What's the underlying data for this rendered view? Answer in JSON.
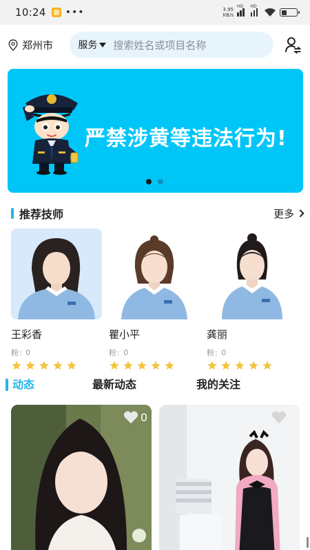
{
  "status_bar": {
    "time": "10:24",
    "dots": "•••",
    "net_speed_value": "3.95",
    "net_speed_unit": "KB/s",
    "signal_tag": "HD",
    "battery_level": 0.35
  },
  "header": {
    "city": "郑州市",
    "search_category": "服务",
    "search_placeholder": "搜索姓名或项目名称"
  },
  "banner": {
    "text": "严禁涉黄等违法行为!",
    "slide_count": 2,
    "active_slide": 1
  },
  "technicians_section": {
    "title": "推荐技师",
    "more_label": "更多",
    "items": [
      {
        "name": "王彩香",
        "fans": "粉: 0",
        "rating": 5
      },
      {
        "name": "瞿小平",
        "fans": "粉: 0",
        "rating": 5
      },
      {
        "name": "龚丽",
        "fans": "粉: 0",
        "rating": 5
      }
    ]
  },
  "feed_tabs": [
    {
      "label": "动态"
    },
    {
      "label": "最新动态"
    },
    {
      "label": "我的关注"
    }
  ],
  "feed": {
    "cards": [
      {
        "likes": "0"
      },
      {
        "likes": ""
      }
    ]
  },
  "colors": {
    "accent": "#20b6ec",
    "banner_bg": "#00c6f8",
    "star": "#f3c540"
  }
}
